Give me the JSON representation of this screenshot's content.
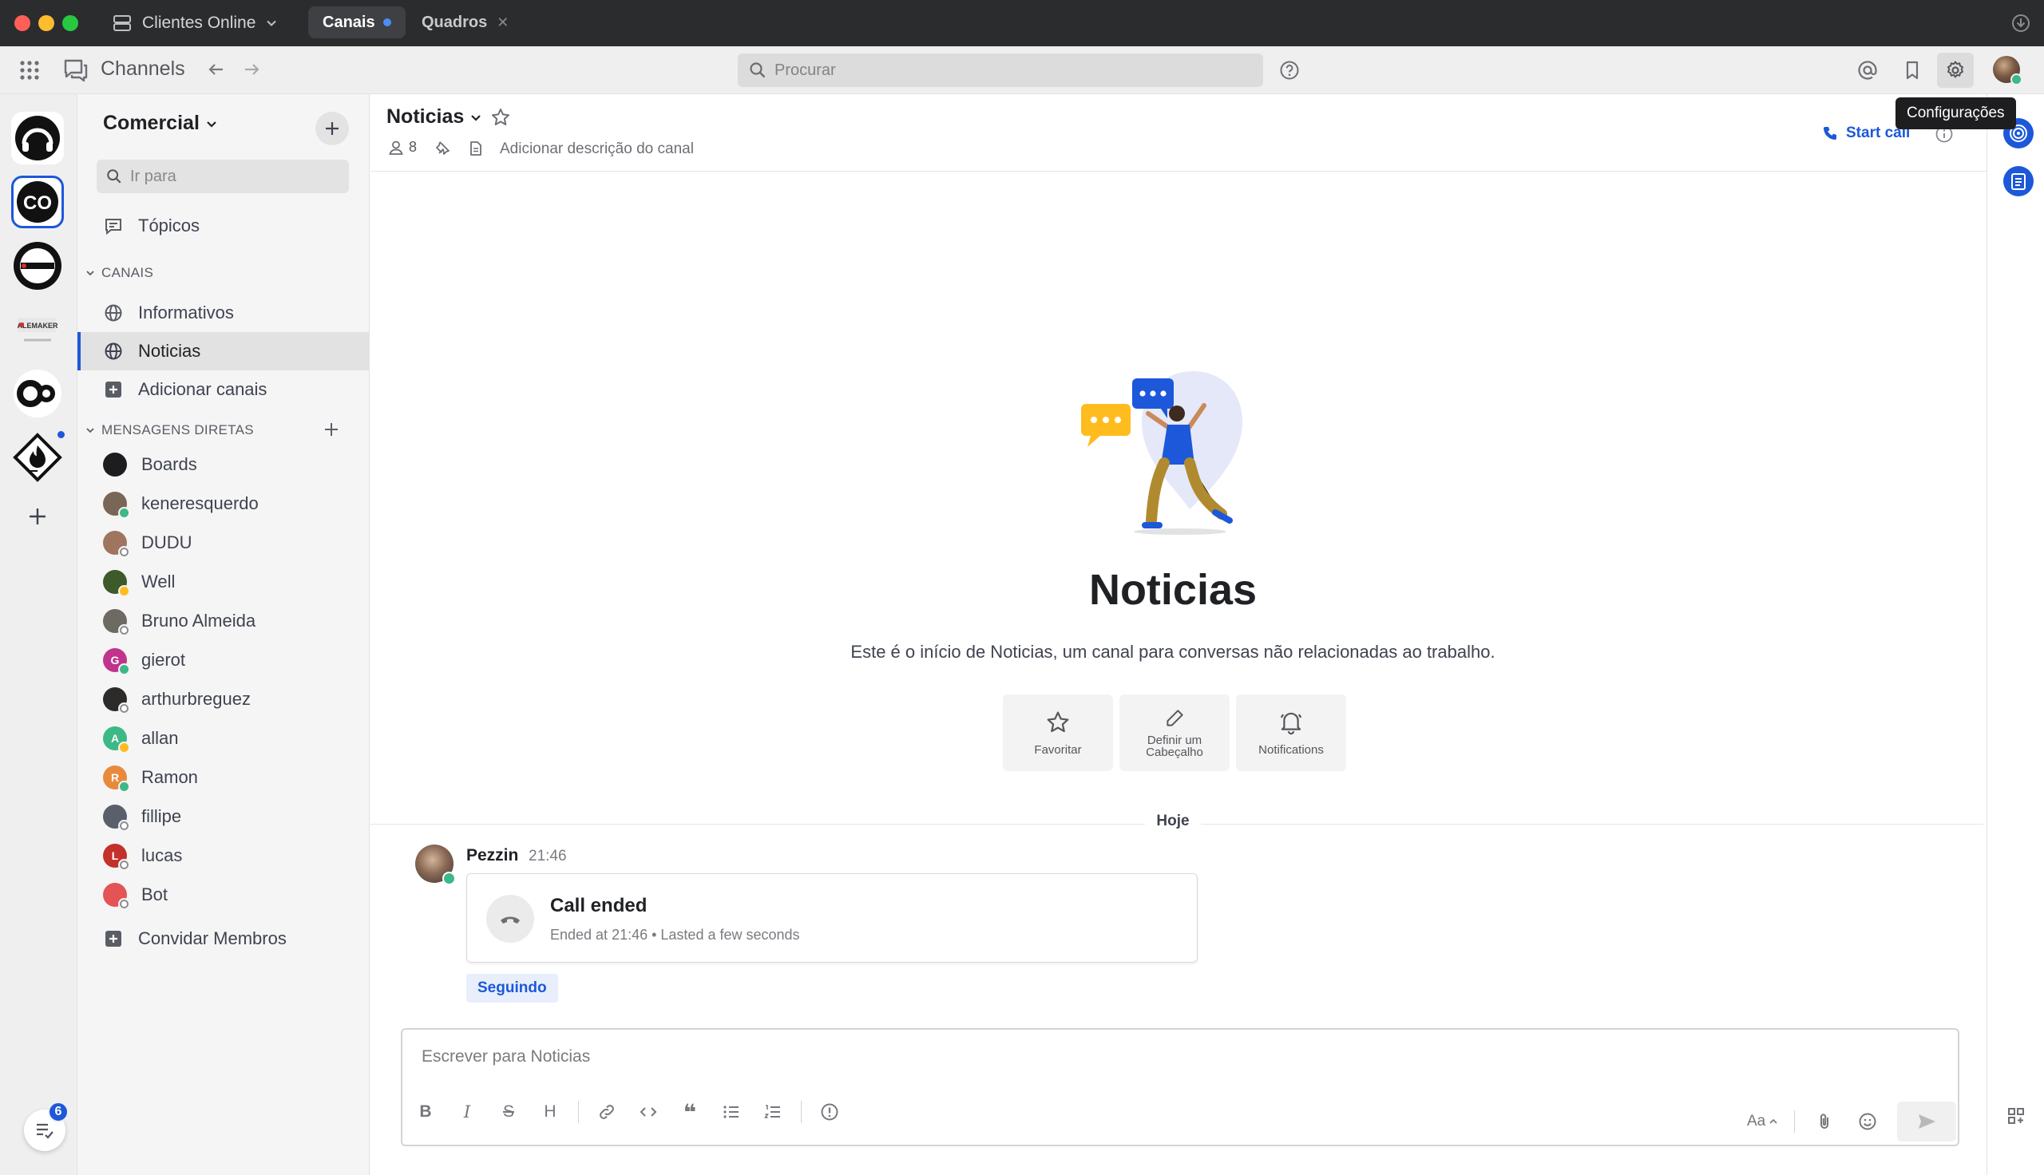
{
  "titlebar": {
    "server_name": "Clientes Online",
    "tabs": [
      {
        "label": "Canais",
        "active": true,
        "unread": true
      },
      {
        "label": "Quadros",
        "active": false
      }
    ]
  },
  "header": {
    "app_title": "Channels",
    "search_placeholder": "Procurar",
    "tooltip": "Configurações"
  },
  "teams": {
    "items": [
      "team-headphones",
      "team-co",
      "team-alemaker",
      "team-alemaker-2",
      "team-co-2",
      "team-flame"
    ],
    "unread_team_index": 5
  },
  "sidebar": {
    "team_name": "Comercial",
    "jump_placeholder": "Ir para",
    "topics_label": "Tópicos",
    "channels_header": "CANAIS",
    "channels": [
      {
        "label": "Informativos",
        "active": false
      },
      {
        "label": "Noticias",
        "active": true
      }
    ],
    "add_channels_label": "Adicionar canais",
    "dm_header": "MENSAGENS DIRETAS",
    "dms": [
      {
        "label": "Boards",
        "status": "none",
        "color": "#1d1d1f",
        "initial": ""
      },
      {
        "label": "keneresquerdo",
        "status": "online",
        "color": "#7a6656",
        "initial": ""
      },
      {
        "label": "DUDU",
        "status": "offline",
        "color": "#a07560",
        "initial": ""
      },
      {
        "label": "Well",
        "status": "away",
        "color": "#3d5a2a",
        "initial": ""
      },
      {
        "label": "Bruno Almeida",
        "status": "offline",
        "color": "#6d6a63",
        "initial": ""
      },
      {
        "label": "gierot",
        "status": "online",
        "color": "#c2338c",
        "initial": "G"
      },
      {
        "label": "arthurbreguez",
        "status": "offline",
        "color": "#2d2b2a",
        "initial": ""
      },
      {
        "label": "allan",
        "status": "away",
        "color": "#3db887",
        "initial": "A"
      },
      {
        "label": "Ramon",
        "status": "online",
        "color": "#e88a3c",
        "initial": "R"
      },
      {
        "label": "fillipe",
        "status": "offline",
        "color": "#5a5f6b",
        "initial": ""
      },
      {
        "label": "lucas",
        "status": "offline",
        "color": "#c4302b",
        "initial": "L"
      },
      {
        "label": "Bot",
        "status": "offline",
        "color": "#e45454",
        "initial": ""
      }
    ],
    "invite_label": "Convidar Membros",
    "badge_count": "6"
  },
  "channel": {
    "name": "Noticias",
    "member_count": "8",
    "add_description": "Adicionar descrição do canal",
    "start_call": "Start call",
    "intro_title": "Noticias",
    "intro_text": "Este é o início de Noticias, um canal para conversas não relacionadas ao trabalho.",
    "actions": [
      {
        "label": "Favoritar",
        "icon": "star-icon"
      },
      {
        "label": "Definir um Cabeçalho",
        "icon": "pencil-icon"
      },
      {
        "label": "Notifications",
        "icon": "bell-icon"
      }
    ],
    "date_separator": "Hoje"
  },
  "message": {
    "author": "Pezzin",
    "time": "21:46",
    "card_title": "Call ended",
    "card_subtitle": "Ended at 21:46 • Lasted a few seconds",
    "follow_label": "Seguindo"
  },
  "composer": {
    "placeholder": "Escrever para Noticias",
    "text_size_label": "Aa"
  },
  "colors": {
    "accent": "#1c58d9",
    "online": "#3db887",
    "away": "#ffbc1f",
    "titlebar": "#2b2c2e"
  }
}
